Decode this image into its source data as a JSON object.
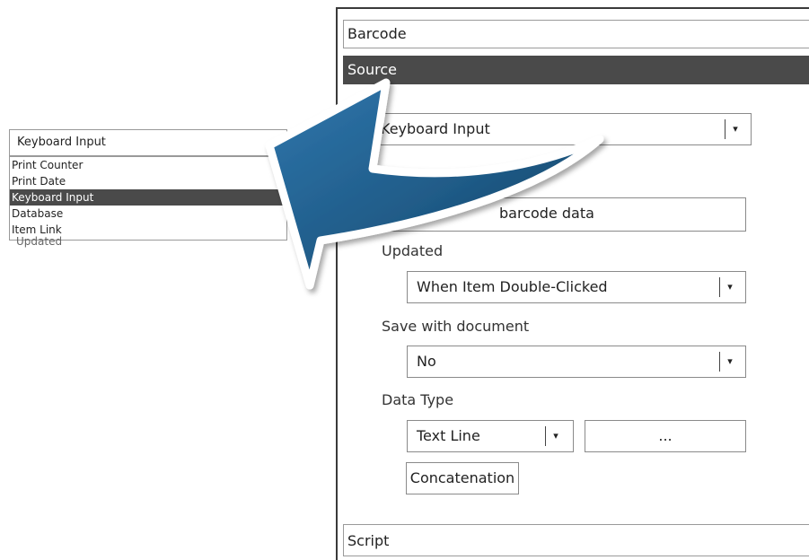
{
  "sections": {
    "barcode": "Barcode",
    "source": "Source",
    "script": "Script"
  },
  "source_panel": {
    "source_type_value": "Keyboard Input",
    "prompt_value": "barcode data",
    "updated_label": "Updated",
    "updated_value": "When Item Double-Clicked",
    "save_label": "Save with document",
    "save_value": "No",
    "data_type_label": "Data Type",
    "data_type_value": "Text Line",
    "data_type_more": "...",
    "concatenation_label": "Concatenation"
  },
  "mini_dropdown": {
    "selected": "Keyboard Input",
    "options": [
      "Print Counter",
      "Print Date",
      "Keyboard Input",
      "Database",
      "Item Link"
    ],
    "selected_index": 2,
    "underlay_text": "Updated"
  },
  "icons": {
    "dropdown": "chevron-down-icon",
    "callout": "curved-arrow-icon"
  },
  "colors": {
    "arrow_fill": "#1f5a86",
    "arrow_dark": "#163f5f",
    "selected_row": "#4a4a4a"
  }
}
